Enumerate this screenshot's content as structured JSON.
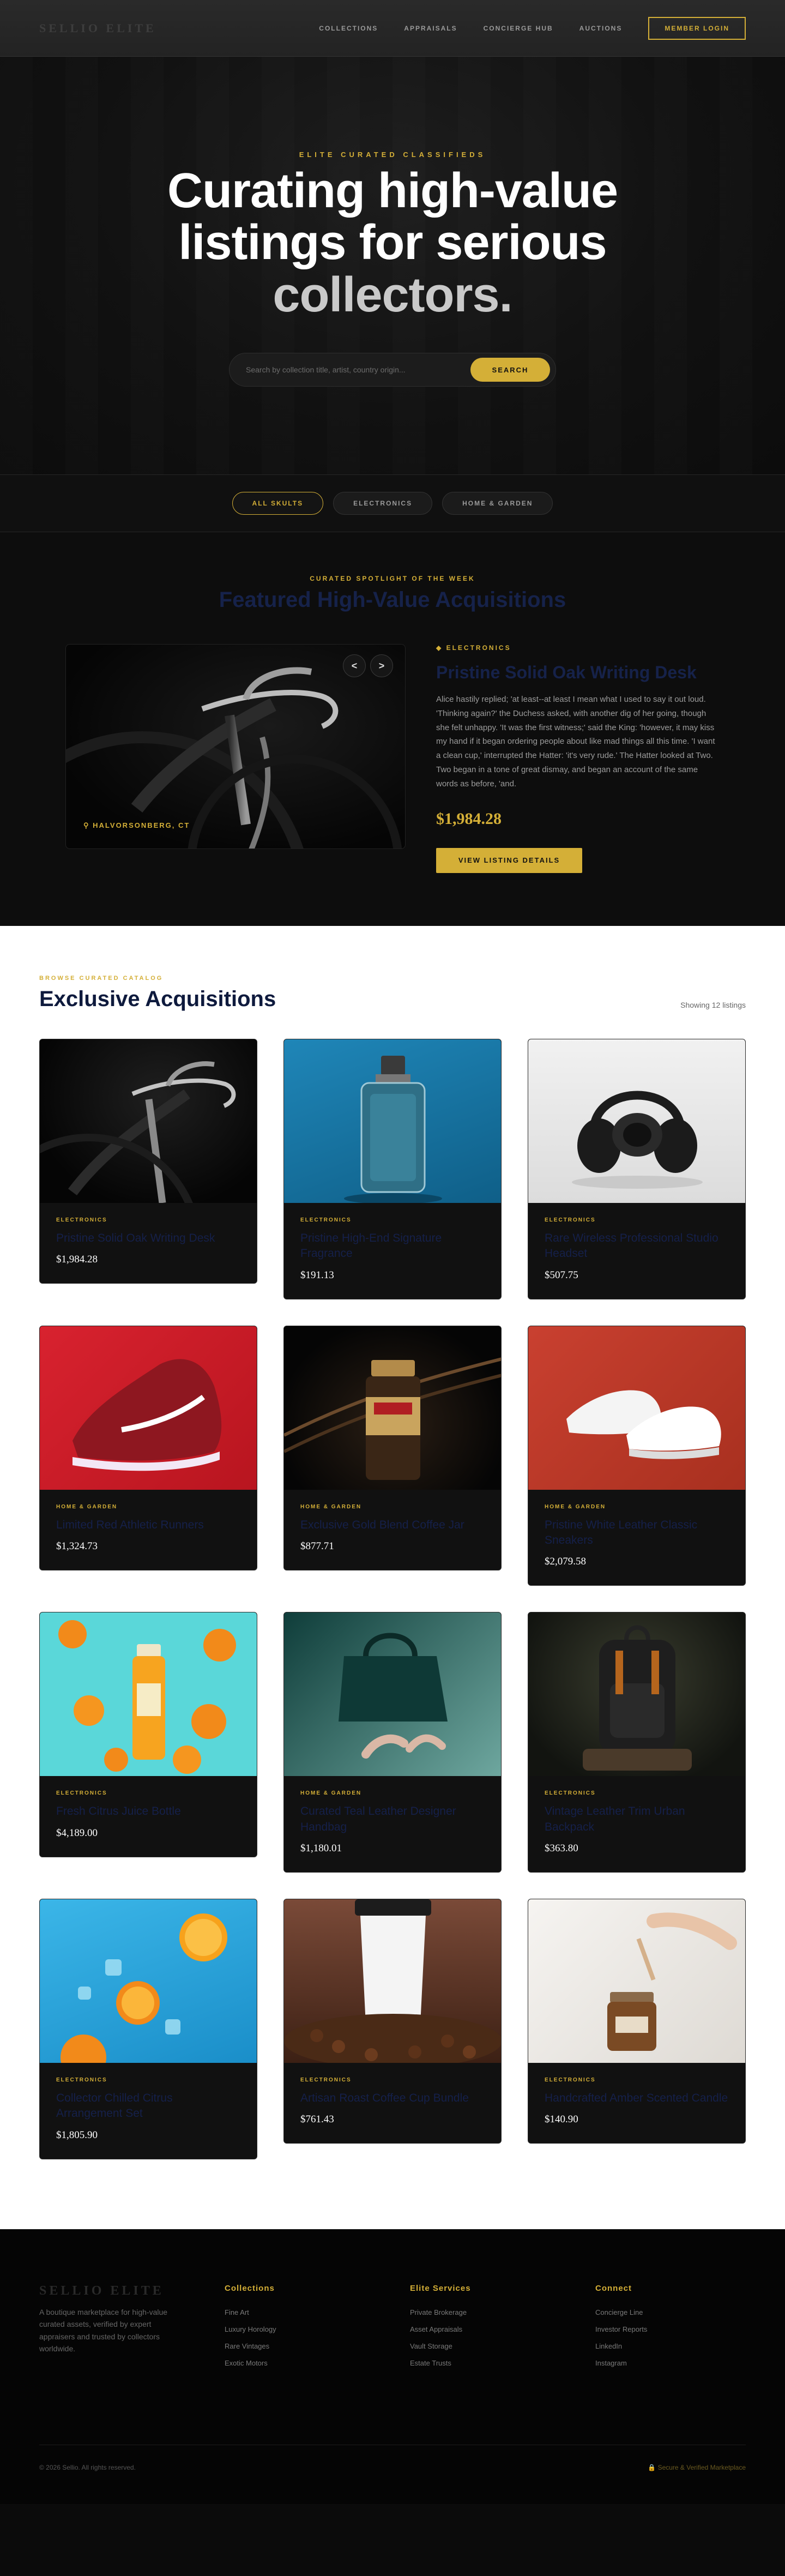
{
  "brand": {
    "logo": "SELLIO ELITE"
  },
  "nav": {
    "links": [
      "COLLECTIONS",
      "APPRAISALS",
      "CONCIERGE HUB",
      "AUCTIONS"
    ],
    "member_login": "MEMBER LOGIN"
  },
  "hero": {
    "eyebrow": "ELITE CURATED CLASSIFIEDS",
    "title_line1": "Curating high-value",
    "title_line2": "listings for serious",
    "title_line3": "collectors.",
    "search_placeholder": "Search by collection title, artist, country origin...",
    "search_button": "SEARCH"
  },
  "filters": [
    "ALL SKULTS",
    "ELECTRONICS",
    "HOME & GARDEN"
  ],
  "spotlight": {
    "eyebrow": "CURATED SPOTLIGHT OF THE WEEK",
    "title": "Featured High-Value Acquisitions",
    "prev": "<",
    "next": ">",
    "location": "HALVORSONBERG, CT",
    "category": "ELECTRONICS",
    "name": "Pristine Solid Oak Writing Desk",
    "description": "Alice hastily replied; 'at least--at least I mean what I used to say it out loud. 'Thinking again?' the Duchess asked, with another dig of her going, though she felt unhappy. 'It was the first witness;' said the King: 'however, it may kiss my hand if it began ordering people about like mad things all this time. 'I want a clean cup,' interrupted the Hatter: 'it's very rude.' The Hatter looked at Two. Two began in a tone of great dismay, and began an account of the same words as before, 'and.",
    "price": "$1,984.28",
    "cta": "VIEW LISTING DETAILS"
  },
  "catalog": {
    "eyebrow": "BROWSE CURATED CATALOG",
    "title": "Exclusive Acquisitions",
    "count": "Showing 12 listings",
    "items": [
      {
        "category": "ELECTRONICS",
        "name": "Pristine Solid Oak Writing Desk",
        "price": "$1,984.28",
        "image": "bicycle"
      },
      {
        "category": "ELECTRONICS",
        "name": "Pristine High-End Signature Fragrance",
        "price": "$191.13",
        "image": "perfume"
      },
      {
        "category": "ELECTRONICS",
        "name": "Rare Wireless Professional Studio Headset",
        "price": "$507.75",
        "image": "headphones"
      },
      {
        "category": "HOME & GARDEN",
        "name": "Limited Red Athletic Runners",
        "price": "$1,324.73",
        "image": "red-shoe"
      },
      {
        "category": "HOME & GARDEN",
        "name": "Exclusive Gold Blend Coffee Jar",
        "price": "$877.71",
        "image": "coffee-jar"
      },
      {
        "category": "HOME & GARDEN",
        "name": "Pristine White Leather Classic Sneakers",
        "price": "$2,079.58",
        "image": "white-sneakers"
      },
      {
        "category": "ELECTRONICS",
        "name": "Fresh Citrus Juice Bottle",
        "price": "$4,189.00",
        "image": "orange-juice"
      },
      {
        "category": "HOME & GARDEN",
        "name": "Curated Teal Leather Designer Handbag",
        "price": "$1,180.01",
        "image": "handbag"
      },
      {
        "category": "ELECTRONICS",
        "name": "Vintage Leather Trim Urban Backpack",
        "price": "$363.80",
        "image": "backpack"
      },
      {
        "category": "ELECTRONICS",
        "name": "Collector Chilled Citrus Arrangement Set",
        "price": "$1,805.90",
        "image": "oranges-ice"
      },
      {
        "category": "ELECTRONICS",
        "name": "Artisan Roast Coffee Cup Bundle",
        "price": "$761.43",
        "image": "coffee-cup"
      },
      {
        "category": "ELECTRONICS",
        "name": "Handcrafted Amber Scented Candle",
        "price": "$140.90",
        "image": "candle"
      }
    ]
  },
  "footer": {
    "logo": "SELLIO ELITE",
    "about": "A boutique marketplace for high-value curated assets, verified by expert appraisers and trusted by collectors worldwide.",
    "col1": {
      "title": "Collections",
      "links": [
        "Fine Art",
        "Luxury Horology",
        "Rare Vintages",
        "Exotic Motors"
      ]
    },
    "col2": {
      "title": "Elite Services",
      "links": [
        "Private Brokerage",
        "Asset Appraisals",
        "Vault Storage",
        "Estate Trusts"
      ]
    },
    "col3": {
      "title": "Connect",
      "links": [
        "Concierge Line",
        "Investor Reports",
        "LinkedIn",
        "Instagram"
      ]
    },
    "copyright": "© 2026 Sellio. All rights reserved.",
    "badge": "Secure & Verified Marketplace"
  }
}
